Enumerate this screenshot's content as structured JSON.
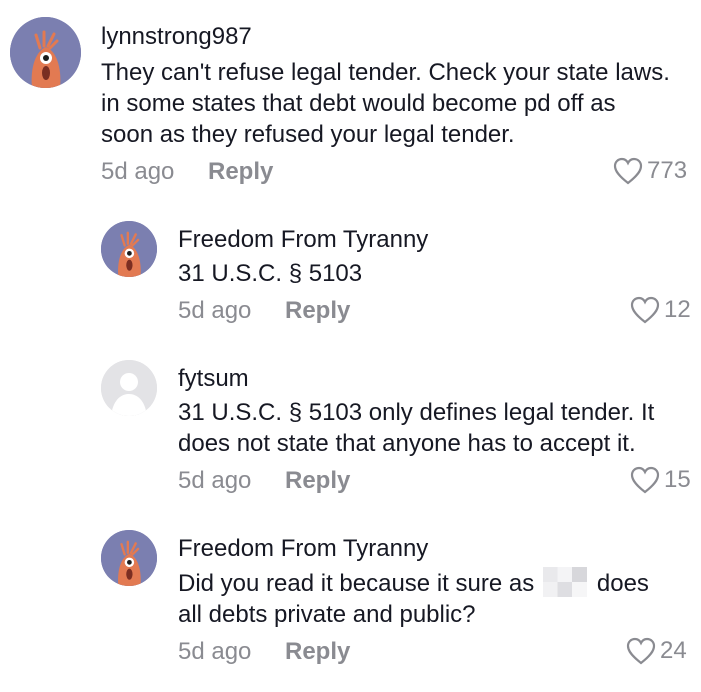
{
  "comments": [
    {
      "username": "lynnstrong987",
      "text": "They can't refuse legal tender. Check your state laws. in some states that debt would become pd off as soon as they refused your legal tender.",
      "time": "5d ago",
      "reply_label": "Reply",
      "likes": "773",
      "avatar": "shrimp-avatar"
    },
    {
      "username": "Freedom From Tyranny",
      "text": "31 U.S.C. § 5103",
      "time": "5d ago",
      "reply_label": "Reply",
      "likes": "12",
      "avatar": "shrimp-avatar"
    },
    {
      "username": "fytsum",
      "text_line1": "31 U.S.C. § 5103 only defines legal tender. It",
      "text_line2": "does not state that anyone has to accept it.",
      "time": "5d ago",
      "reply_label": "Reply",
      "likes": "15",
      "avatar": "default-avatar"
    },
    {
      "username": "Freedom From Tyranny",
      "text_before": "Did you read it because it sure as",
      "text_after": "does",
      "text_line2": "all debts private and public?",
      "time": "5d ago",
      "reply_label": "Reply",
      "likes": "24",
      "avatar": "shrimp-avatar"
    }
  ],
  "colors": {
    "avatar_bg": "#7b7fb0",
    "shrimp": "#e27a52",
    "meta": "#8a8b91",
    "text": "#161823"
  }
}
